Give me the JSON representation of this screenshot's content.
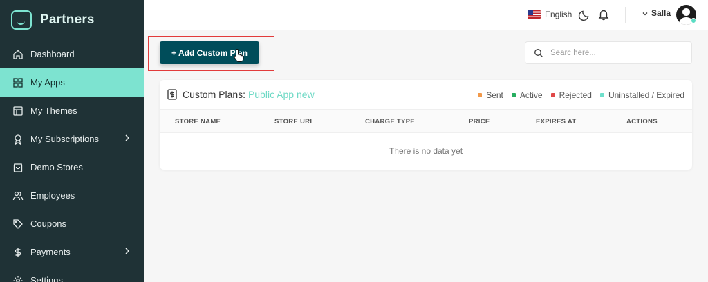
{
  "app": {
    "brand": "Partners"
  },
  "sidebar": {
    "items": [
      {
        "label": "Dashboard",
        "icon": "home-icon",
        "active": false,
        "has_children": false
      },
      {
        "label": "My Apps",
        "icon": "grid-icon",
        "active": true,
        "has_children": false
      },
      {
        "label": "My Themes",
        "icon": "layout-icon",
        "active": false,
        "has_children": false
      },
      {
        "label": "My Subscriptions",
        "icon": "award-icon",
        "active": false,
        "has_children": true
      },
      {
        "label": "Demo Stores",
        "icon": "shopping-bag-icon",
        "active": false,
        "has_children": false
      },
      {
        "label": "Employees",
        "icon": "users-icon",
        "active": false,
        "has_children": false
      },
      {
        "label": "Coupons",
        "icon": "tag-icon",
        "active": false,
        "has_children": false
      },
      {
        "label": "Payments",
        "icon": "dollar-icon",
        "active": false,
        "has_children": true
      },
      {
        "label": "Settings",
        "icon": "gear-icon",
        "active": false,
        "has_children": false
      }
    ]
  },
  "topbar": {
    "language": "English",
    "user_name": "Salla"
  },
  "toolbar": {
    "add_button_label": "+ Add Custom Plan",
    "search_placeholder": "Searc here..."
  },
  "card": {
    "title_prefix": "Custom Plans:",
    "app_name": "Public App new",
    "legend": [
      {
        "label": "Sent",
        "color": "#f2994a"
      },
      {
        "label": "Active",
        "color": "#27ae60"
      },
      {
        "label": "Rejected",
        "color": "#e04848"
      },
      {
        "label": "Uninstalled / Expired",
        "color": "#6fe0cc"
      }
    ],
    "columns": [
      "STORE NAME",
      "STORE URL",
      "CHARGE TYPE",
      "PRICE",
      "EXPIRES AT",
      "ACTIONS"
    ],
    "empty_text": "There is no data yet"
  },
  "colors": {
    "sidebar_bg": "#1f3236",
    "accent": "#7de3d0",
    "primary_button": "#004d5a",
    "highlight": "#e23b3b"
  }
}
